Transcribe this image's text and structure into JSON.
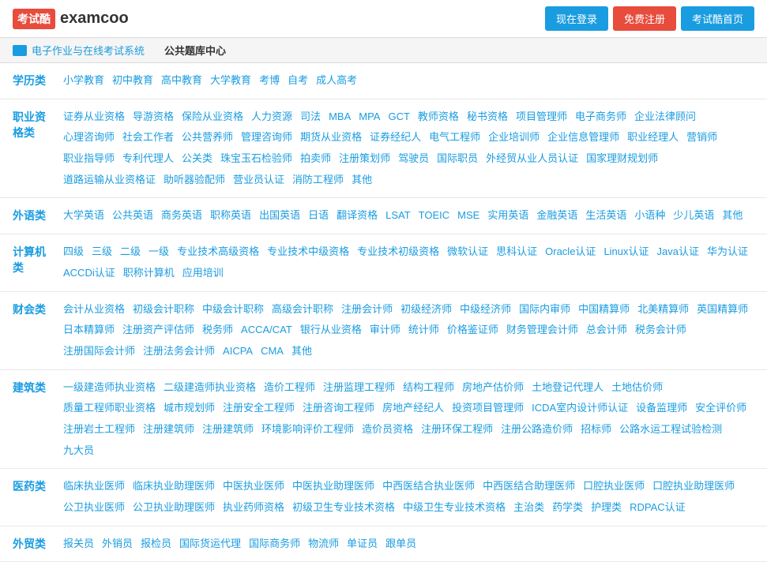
{
  "header": {
    "logo_badge": "考试酷",
    "logo_text": "examcoo",
    "btn_login": "现在登录",
    "btn_register": "免费注册",
    "btn_home": "考试酷首页"
  },
  "breadcrumb": {
    "link_text": "电子作业与在线考试系统",
    "current": "公共题库中心"
  },
  "categories": [
    {
      "label": "学历类",
      "links": [
        "小学教育",
        "初中教育",
        "高中教育",
        "大学教育",
        "考博",
        "自考",
        "成人高考"
      ]
    },
    {
      "label": "职业资格类",
      "links": [
        "证券从业资格",
        "导游资格",
        "保险从业资格",
        "人力资源",
        "司法",
        "MBA",
        "MPA",
        "GCT",
        "教师资格",
        "秘书资格",
        "项目管理师",
        "电子商务师",
        "企业法律顾问",
        "心理咨询师",
        "社会工作者",
        "公共营养师",
        "管理咨询师",
        "期货从业资格",
        "证券经纪人",
        "电气工程师",
        "企业培训师",
        "企业信息管理师",
        "职业经理人",
        "营销师",
        "职业指导师",
        "专利代理人",
        "公关类",
        "珠宝玉石检验师",
        "拍卖师",
        "注册策划师",
        "驾驶员",
        "国际职员",
        "外经贸从业人员认证",
        "国家理财规划师",
        "道路运输从业资格证",
        "助听器验配师",
        "营业员认证",
        "消防工程师",
        "其他"
      ]
    },
    {
      "label": "外语类",
      "links": [
        "大学英语",
        "公共英语",
        "商务英语",
        "职称英语",
        "出国英语",
        "日语",
        "翻译资格",
        "LSAT",
        "TOEIC",
        "MSE",
        "实用英语",
        "金融英语",
        "生活英语",
        "小语种",
        "少儿英语",
        "其他"
      ]
    },
    {
      "label": "计算机类",
      "links": [
        "四级",
        "三级",
        "二级",
        "一级",
        "专业技术高级资格",
        "专业技术中级资格",
        "专业技术初级资格",
        "微软认证",
        "思科认证",
        "Oracle认证",
        "Linux认证",
        "Java认证",
        "华为认证",
        "ACCDi认证",
        "职称计算机",
        "应用培训"
      ]
    },
    {
      "label": "财会类",
      "links": [
        "会计从业资格",
        "初级会计职称",
        "中级会计职称",
        "高级会计职称",
        "注册会计师",
        "初级经济师",
        "中级经济师",
        "国际内审师",
        "中国精算师",
        "北美精算师",
        "英国精算师",
        "日本精算师",
        "注册资产评估师",
        "税务师",
        "ACCA/CAT",
        "银行从业资格",
        "审计师",
        "统计师",
        "价格鉴证师",
        "财务管理会计师",
        "总会计师",
        "税务会计师",
        "注册国际会计师",
        "注册法务会计师",
        "AICPA",
        "CMA",
        "其他"
      ]
    },
    {
      "label": "建筑类",
      "links": [
        "一级建造师执业资格",
        "二级建造师执业资格",
        "造价工程师",
        "注册监理工程师",
        "结构工程师",
        "房地产估价师",
        "土地登记代理人",
        "土地估价师",
        "质量工程师职业资格",
        "城市规划师",
        "注册安全工程师",
        "注册咨询工程师",
        "房地产经纪人",
        "投资项目管理师",
        "ICDA室内设计师认证",
        "设备监理师",
        "安全评价师",
        "注册岩土工程师",
        "注册建筑师",
        "注册建筑师",
        "环境影响评价工程师",
        "造价员资格",
        "注册环保工程师",
        "注册公路造价师",
        "招标师",
        "公路水运工程试验检测",
        "九大员"
      ]
    },
    {
      "label": "医药类",
      "links": [
        "临床执业医师",
        "临床执业助理医师",
        "中医执业医师",
        "中医执业助理医师",
        "中西医结合执业医师",
        "中西医结合助理医师",
        "口腔执业医师",
        "口腔执业助理医师",
        "公卫执业医师",
        "公卫执业助理医师",
        "执业药师资格",
        "初级卫生专业技术资格",
        "中级卫生专业技术资格",
        "主治类",
        "药学类",
        "护理类",
        "RDPAC认证"
      ]
    },
    {
      "label": "外贸类",
      "links": [
        "报关员",
        "外销员",
        "报检员",
        "国际货运代理",
        "国际商务师",
        "物流师",
        "单证员",
        "跟单员"
      ]
    }
  ]
}
